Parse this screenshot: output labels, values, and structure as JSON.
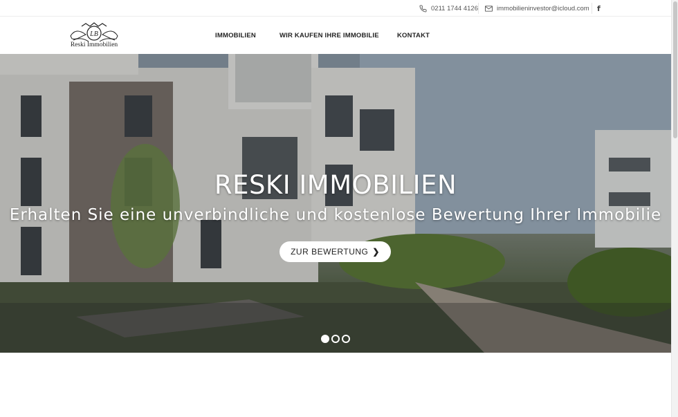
{
  "topbar": {
    "phone": "0211 1744 4126",
    "email": "immobilieninvestor@icloud.com",
    "social_icon": "f"
  },
  "header": {
    "logo_text": "Reski Immobilien",
    "logo_monogram": "LB",
    "nav": [
      {
        "label": "IMMOBILIEN"
      },
      {
        "label": "WIR KAUFEN IHRE IMMOBILIE"
      },
      {
        "label": "KONTAKT"
      }
    ]
  },
  "hero": {
    "title": "RESKI IMMOBILIEN",
    "subtitle": "Erhalten Sie eine unverbindliche und kostenlose Bewertung Ihrer Immobilie",
    "button_label": "ZUR BEWERTUNG",
    "button_icon": "chevron-right-icon",
    "slides": 3,
    "active_slide": 1
  },
  "colors": {
    "text": "#222222",
    "hero_text": "#ffffff",
    "button_bg": "#ffffff"
  }
}
